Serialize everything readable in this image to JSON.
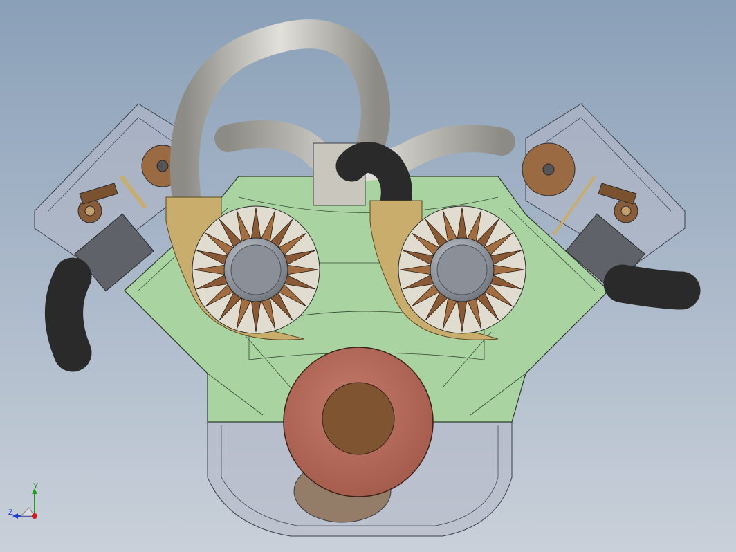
{
  "viewport": {
    "background_top": "#8aa0b8",
    "background_bottom": "#c9d0d9"
  },
  "model": {
    "colors": {
      "block_green": "#a9d3a1",
      "brass": "#c8ad6d",
      "copper": "#b66c5c",
      "bronze": "#7a5230",
      "pipe_silver": "#b9b7b0",
      "hose_black": "#2a2a2a",
      "glass_gray": "#b4b8c6"
    }
  },
  "triad": {
    "y_label": "Y",
    "z_label": "Z",
    "x_color": "#d41a1a",
    "y_color": "#1aa01a",
    "z_color": "#1a3fd4"
  }
}
